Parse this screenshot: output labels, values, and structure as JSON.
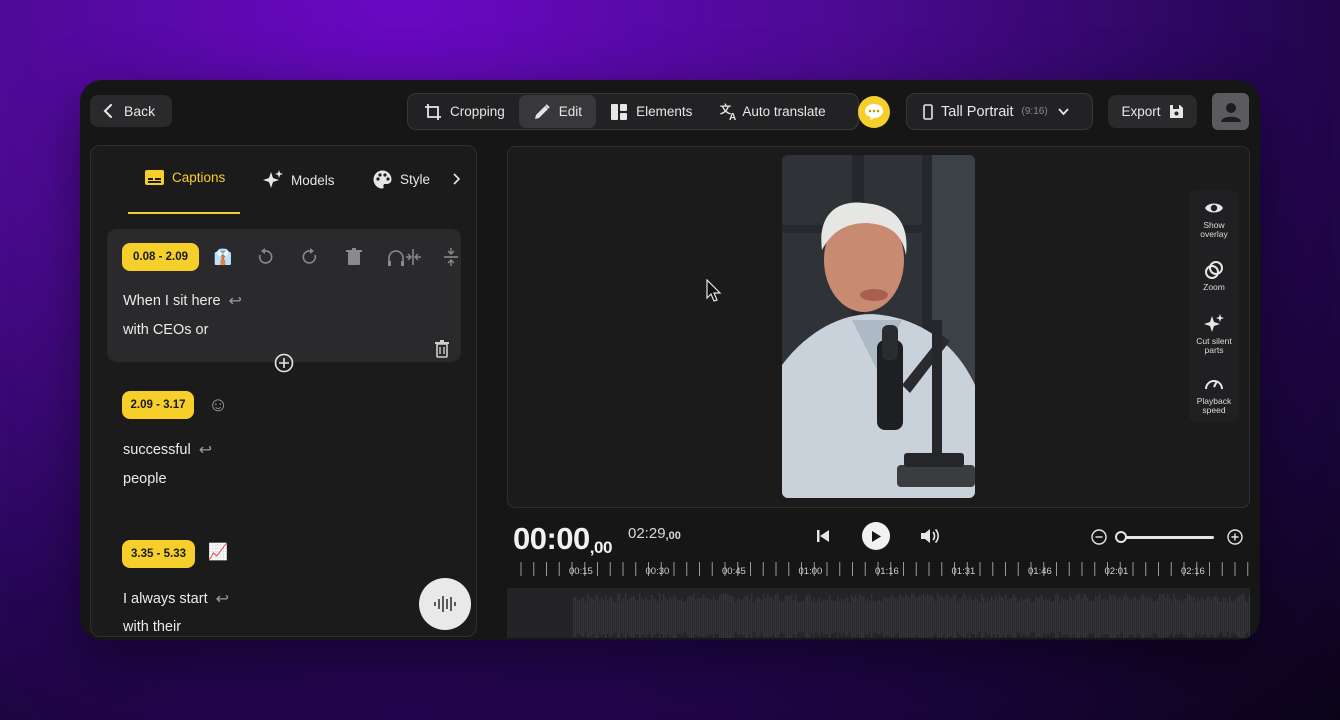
{
  "top_bar": {
    "back_label": "Back",
    "tabs": [
      {
        "label": "Cropping",
        "icon": "crop-icon"
      },
      {
        "label": "Edit",
        "icon": "pencil-icon"
      },
      {
        "label": "Elements",
        "icon": "elements-icon"
      },
      {
        "label": "Auto translate",
        "icon": "translate-icon"
      }
    ],
    "active_tab": "Edit",
    "format": {
      "label": "Tall Portrait",
      "ratio": "(9:16)"
    },
    "export_label": "Export"
  },
  "side_tabs": [
    {
      "label": "Captions",
      "icon": "captions-icon"
    },
    {
      "label": "Models",
      "icon": "sparkle-icon"
    },
    {
      "label": "Style",
      "icon": "palette-icon"
    }
  ],
  "captions": [
    {
      "time": "0.08 - 2.09",
      "emoji": "👔",
      "lines": [
        "When I sit here",
        "with CEOs or"
      ]
    },
    {
      "time": "2.09 - 3.17",
      "emoji": "☺",
      "lines": [
        "successful",
        "people"
      ]
    },
    {
      "time": "3.35 - 5.33",
      "emoji": "📈",
      "lines": [
        "I always start",
        "with their"
      ]
    }
  ],
  "right_tools": [
    {
      "label": "Show overlay",
      "icon": "eye-icon"
    },
    {
      "label": "Zoom",
      "icon": "zoom-rings-icon"
    },
    {
      "label": "Cut silent parts",
      "icon": "sparkle-icon"
    },
    {
      "label": "Playback speed",
      "icon": "speedometer-icon"
    }
  ],
  "player": {
    "current_main": "00:00",
    "current_frac": ",00",
    "total_main": "02:29",
    "total_frac": ",00",
    "zoom_level": 0.0
  },
  "timeline": {
    "tick_labels": [
      "00:15",
      "00:30",
      "00:45",
      "01:00",
      "01:16",
      "01:31",
      "01:46",
      "02:01",
      "02:16"
    ]
  },
  "colors": {
    "accent": "#f7cf2a",
    "window": "#161617",
    "panel": "#1b1b1c"
  }
}
